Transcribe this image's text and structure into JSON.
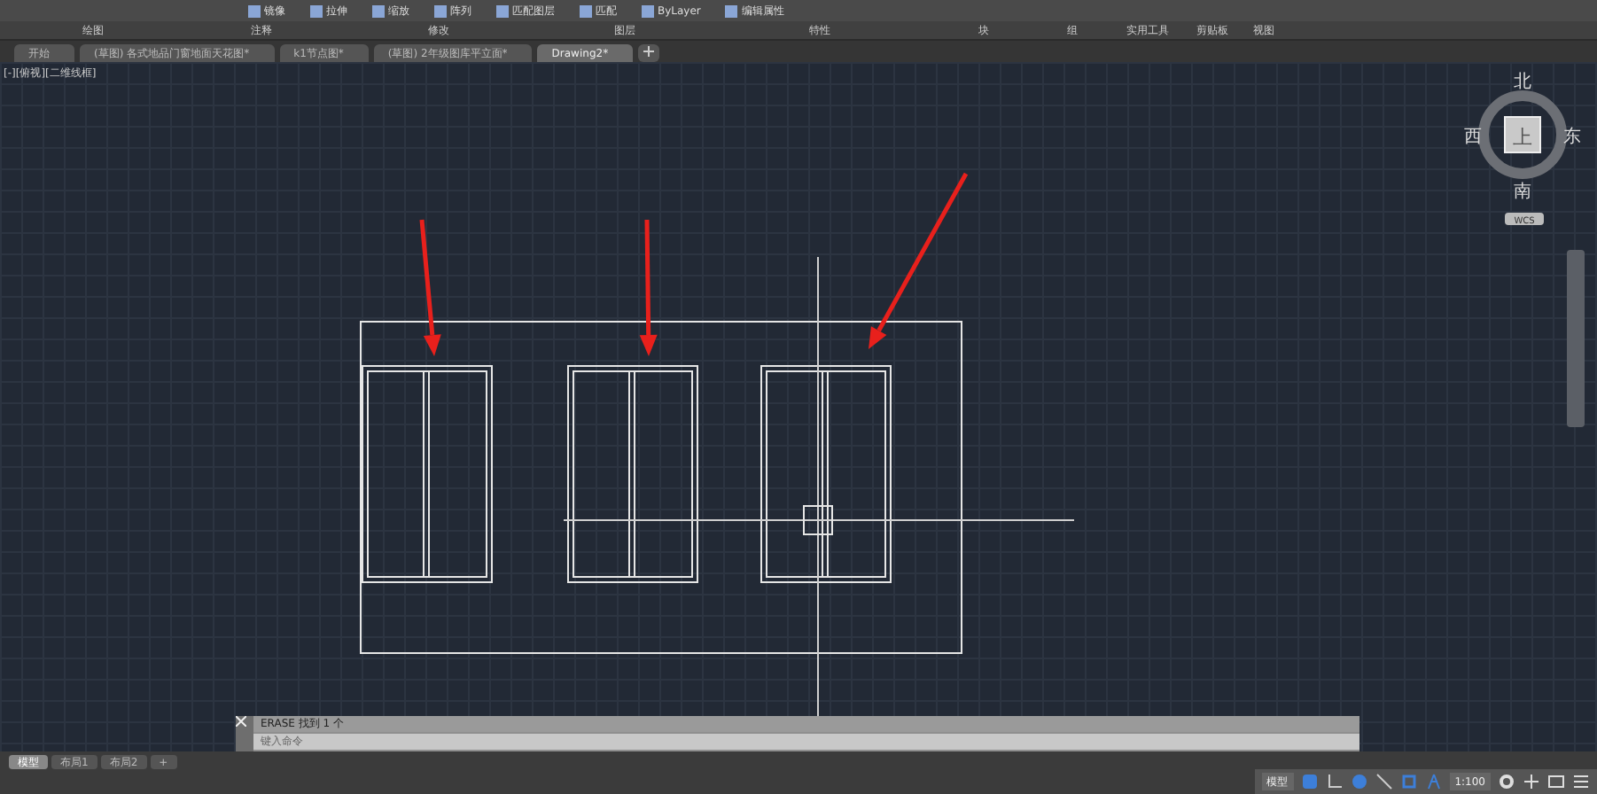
{
  "ribbon": {
    "tools": [
      {
        "label": "镜像"
      },
      {
        "label": "拉伸"
      },
      {
        "label": "缩放"
      },
      {
        "label": "阵列"
      },
      {
        "label": "匹配图层"
      },
      {
        "label": "匹配"
      },
      {
        "label": "ByLayer"
      },
      {
        "label": "编辑属性"
      }
    ],
    "panels": [
      "绘图",
      "注释",
      "修改",
      "图层",
      "特性",
      "块",
      "组",
      "实用工具",
      "剪贴板",
      "视图"
    ]
  },
  "file_tabs": [
    {
      "label": "开始",
      "selected": false
    },
    {
      "label": "(草图) 各式地品门窗地面天花图*",
      "selected": false
    },
    {
      "label": "k1节点图*",
      "selected": false
    },
    {
      "label": "(草图) 2年级图库平立面*",
      "selected": false
    },
    {
      "label": "Drawing2*",
      "selected": true
    }
  ],
  "viewport": {
    "label": "[-][俯视][二维线框]",
    "viewcube": {
      "north": "北",
      "south": "南",
      "east": "东",
      "west": "西",
      "top": "上",
      "ucs": "WCS"
    }
  },
  "command_line": {
    "history": "ERASE 找到 1 个",
    "placeholder": "键入命令"
  },
  "layout_tabs": [
    {
      "label": "模型",
      "selected": true
    },
    {
      "label": "布局1",
      "selected": false
    },
    {
      "label": "布局2",
      "selected": false
    },
    {
      "label": "+",
      "selected": false
    }
  ],
  "status_bar": {
    "model": "模型",
    "scale": "1:100"
  }
}
